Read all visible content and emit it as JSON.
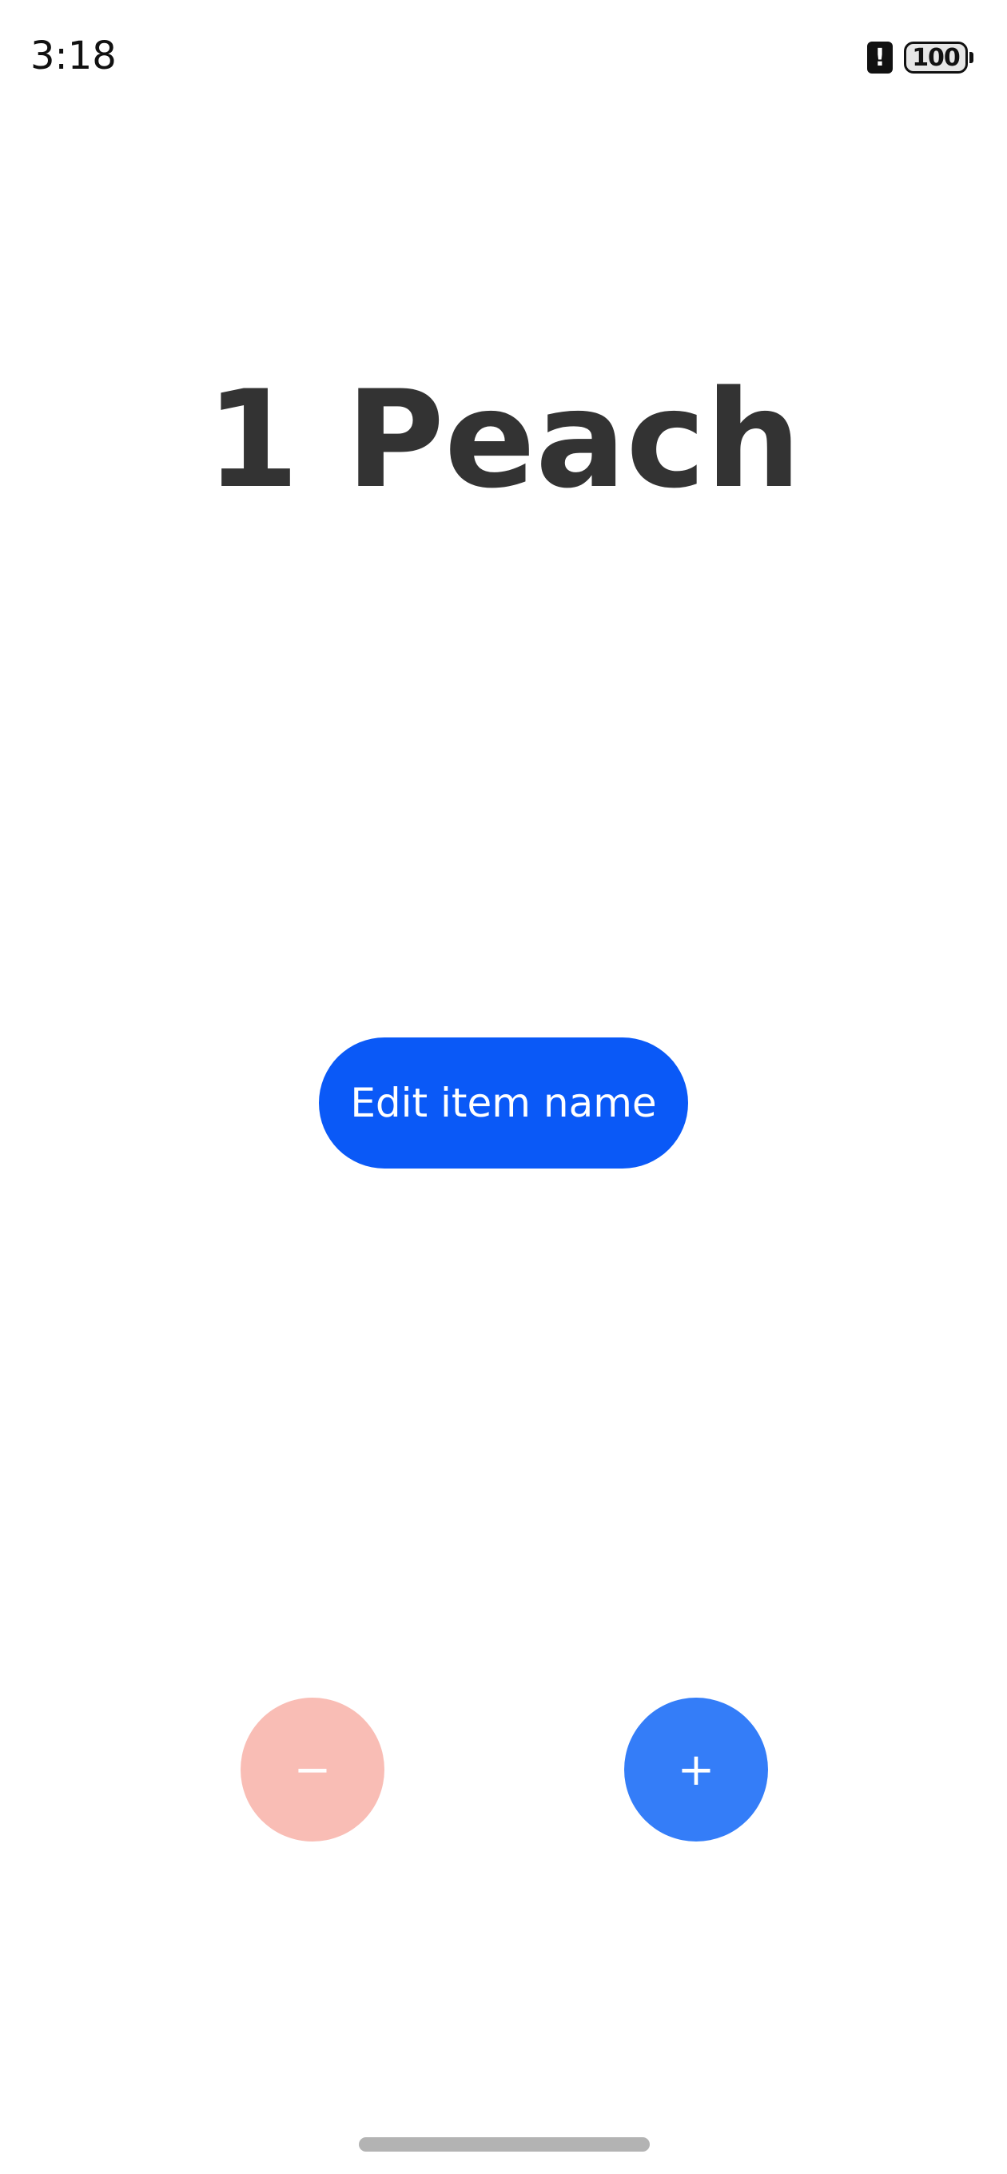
{
  "status_bar": {
    "time": "3:18",
    "alert_glyph": "!",
    "battery_level": "100"
  },
  "main": {
    "title": "1 Peach",
    "edit_button_label": "Edit item name"
  },
  "controls": {
    "decrement_label": "−",
    "increment_label": "+"
  },
  "colors": {
    "primary": "#0a59f7",
    "increment_bg": "#347df8",
    "decrement_bg": "#f9bdb5",
    "title_text": "#333333"
  },
  "icons": {
    "alert": "alert-icon",
    "battery": "battery-icon",
    "home_indicator": "home-indicator"
  }
}
